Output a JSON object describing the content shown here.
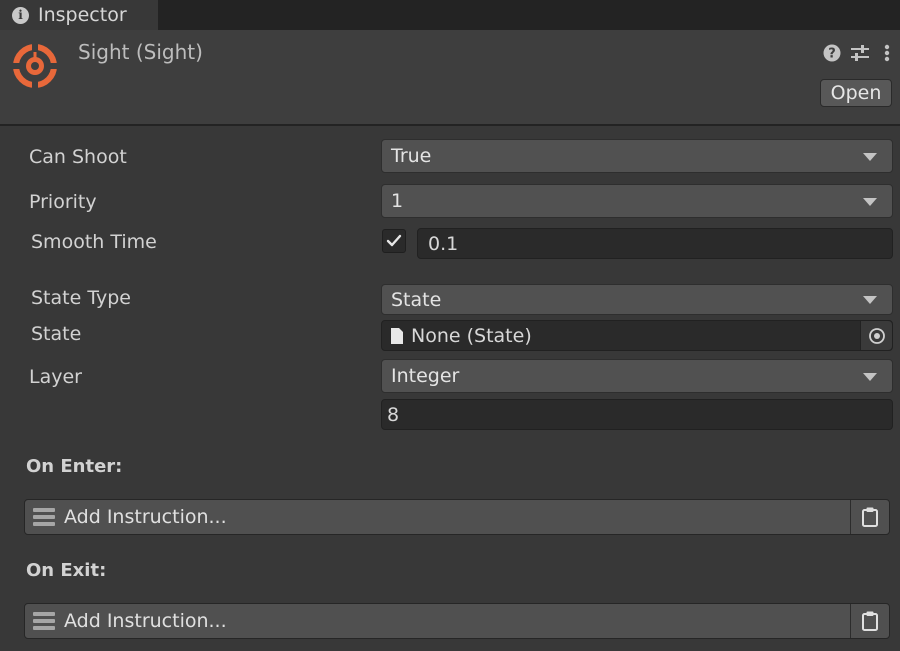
{
  "tab": {
    "icon": "info-icon",
    "label": "Inspector"
  },
  "header": {
    "icon": "target-icon",
    "title": "Sight (Sight)",
    "accent_color": "#e8683a",
    "buttons": [
      {
        "icon": "help-icon"
      },
      {
        "icon": "sliders-icon"
      },
      {
        "icon": "more-vertical-icon"
      }
    ],
    "open_label": "Open"
  },
  "properties": {
    "can_shoot": {
      "label": "Can Shoot",
      "value": "True"
    },
    "priority": {
      "label": "Priority",
      "value": "1"
    },
    "smooth_time": {
      "label": "Smooth Time",
      "enabled": true,
      "value": "0.1"
    },
    "state_type": {
      "label": "State Type",
      "value": "State"
    },
    "state": {
      "label": "State",
      "value": "None (State)"
    },
    "layer": {
      "label": "Layer",
      "value": "Integer",
      "number": "8"
    }
  },
  "sections": {
    "on_enter": {
      "label": "On Enter:",
      "button": "Add Instruction..."
    },
    "on_exit": {
      "label": "On Exit:",
      "button": "Add Instruction..."
    }
  }
}
